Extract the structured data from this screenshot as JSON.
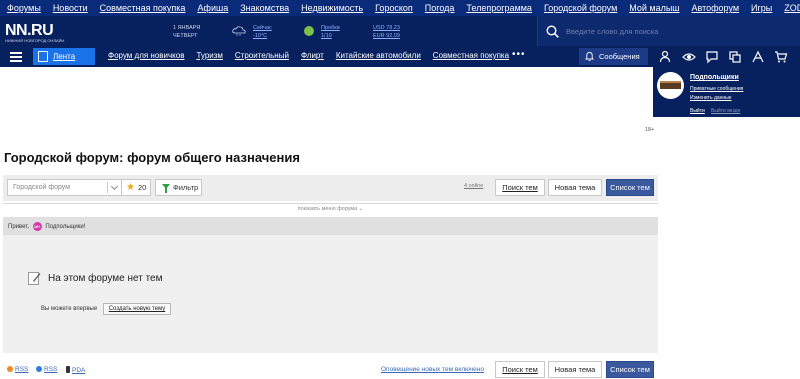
{
  "topnav": [
    "Форумы",
    "Новости",
    "Совместная покупка",
    "Афиша",
    "Знакомства",
    "Недвижимость",
    "Гороскоп",
    "Погода",
    "Телепрограмма",
    "Городской форум",
    "Мой малыш",
    "Автофорум",
    "Игры",
    "ZODY"
  ],
  "header": {
    "logo": "NN.RU",
    "logo_sub": "НИЖНИЙ НОВГОРОД ОНЛАЙН",
    "date_day": "1 ЯНВАРЯ",
    "date_weekday": "ЧЕТВЕРГ",
    "weather_label": "Сейчас",
    "weather_value": "-10°C",
    "traffic_label": "Пробки",
    "traffic_value": "1/10",
    "usd": "USD 78.23",
    "eur": "EUR 92.09",
    "search_placeholder": "Введите слово для поиска"
  },
  "subnav": {
    "lenta": "Лента",
    "links": [
      "Форум для новичков",
      "Туризм",
      "Строительный",
      "Флирт",
      "Китайские автомобили",
      "Совместная покупка"
    ],
    "more": "•••",
    "messages": "Сообщения"
  },
  "user_menu": {
    "name": "Подпольщики",
    "private_messages": "Приватные сообщения",
    "edit": "Изменить данные",
    "logout": "Выйти",
    "logout_all": "Выйти везде"
  },
  "age_label": "18+",
  "page_title": "Городской форум: форум общего назначения",
  "toolbar": {
    "forum_select_placeholder": "Городской форум",
    "favorites_count": "20",
    "filter_label": "Фильтр",
    "online": "4 online",
    "search_topics": "Поиск тем",
    "new_topic": "Новая тема",
    "topic_list": "Список тем",
    "show_menu": "показать меню форума"
  },
  "greeting": {
    "prefix": "Привет,",
    "badge": "18+",
    "name": "Подпольщики!"
  },
  "empty": {
    "title": "На этом форуме нет тем",
    "sub": "Вы можете впервые",
    "create_btn": "Создать новую тему"
  },
  "footer": {
    "rss1": "RSS",
    "rss2": "RSS",
    "pda": "PDA",
    "notify": "Оповещение новых тем включено",
    "search_topics": "Поиск тем",
    "new_topic": "Новая тема",
    "topic_list": "Список тем"
  },
  "colors": {
    "header_bg": "#07205e",
    "topnav_bg": "#0a2a7a",
    "accent_blue": "#1a73e8",
    "primary_btn": "#3b5a9e"
  }
}
